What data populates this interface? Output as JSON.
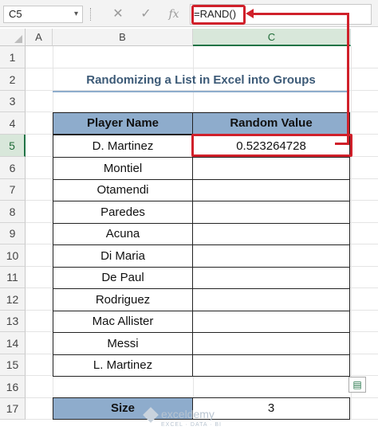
{
  "formula_bar": {
    "name_box": "C5",
    "cancel_icon": "✕",
    "enter_icon": "✓",
    "fx_icon": "fx",
    "formula": "=RAND()"
  },
  "columns": [
    "A",
    "B",
    "C"
  ],
  "rows": [
    "1",
    "2",
    "3",
    "4",
    "5",
    "6",
    "7",
    "8",
    "9",
    "10",
    "11",
    "12",
    "13",
    "14",
    "15",
    "16",
    "17"
  ],
  "title": "Randomizing a List in Excel into Groups",
  "table": {
    "headers": [
      "Player Name",
      "Random Value"
    ],
    "players": [
      "D. Martinez",
      "Montiel",
      "Otamendi",
      "Paredes",
      "Acuna",
      "Di Maria",
      "De Paul",
      "Rodriguez",
      "Mac Allister",
      "Messi",
      "L. Martinez"
    ],
    "c5_value": "0.523264728"
  },
  "size": {
    "label": "Size",
    "value": "3"
  },
  "watermark": {
    "name": "exceldemy",
    "tagline": "EXCEL · DATA · BI"
  },
  "colors": {
    "header_fill": "#8eaccc",
    "highlight": "#d0202a",
    "selection": "#217346"
  }
}
